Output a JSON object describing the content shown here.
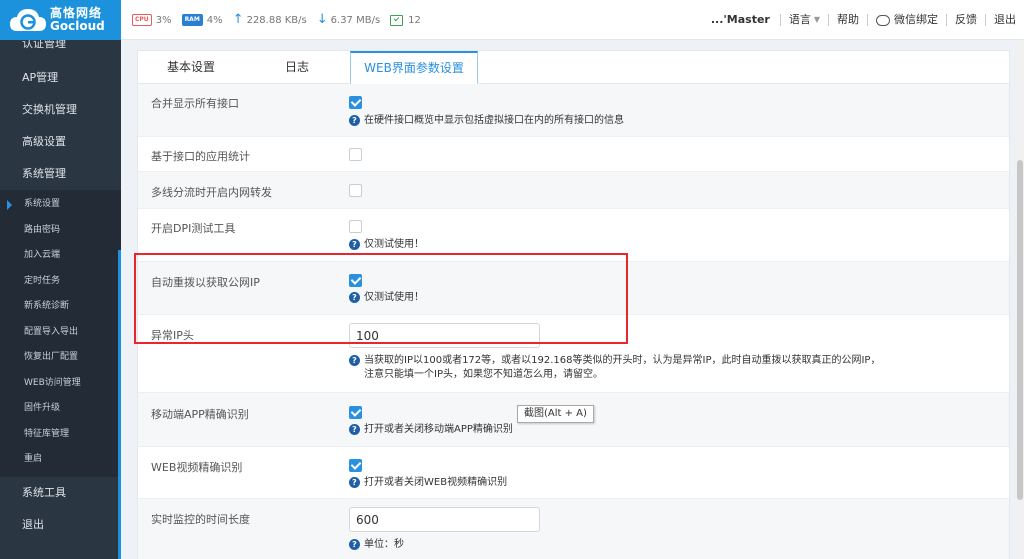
{
  "brand": {
    "name_cn": "高恪网络",
    "name_en": "Gocloud",
    "color": "#1c92dd"
  },
  "stats": {
    "cpu_chip": "CPU",
    "cpu": "3%",
    "ram_chip": "RAM",
    "ram": "4%",
    "upload": "228.88 KB/s",
    "download": "6.37 MB/s",
    "devices": "12"
  },
  "topnav": {
    "user": "...'Master",
    "language": "语言",
    "help": "帮助",
    "wechat": "微信绑定",
    "feedback": "反馈",
    "logout": "退出"
  },
  "sidebar": {
    "items_top": [
      "认证管理",
      "AP管理",
      "交换机管理",
      "高级设置",
      "系统管理"
    ],
    "submenu": [
      "系统设置",
      "路由密码",
      "加入云端",
      "定时任务",
      "新系统诊断",
      "配置导入导出",
      "恢复出厂配置",
      "WEB访问管理",
      "固件升级",
      "特征库管理",
      "重启"
    ],
    "active_sub": "系统设置",
    "items_bottom": [
      "系统工具",
      "退出"
    ]
  },
  "tabs": [
    {
      "label": "基本设置",
      "active": false
    },
    {
      "label": "日志",
      "active": false
    },
    {
      "label": "WEB界面参数设置",
      "active": true
    }
  ],
  "rows": {
    "merge_ports": {
      "label": "合并显示所有接口",
      "checked": true,
      "help": "在硬件接口概览中显示包括虚拟接口在内的所有接口的信息"
    },
    "app_stats": {
      "label": "基于接口的应用统计",
      "checked": false
    },
    "multiline": {
      "label": "多线分流时开启内网转发",
      "checked": false
    },
    "dpi": {
      "label": "开启DPI测试工具",
      "checked": false,
      "help": "仅测试使用！"
    },
    "auto_redial": {
      "label": "自动重拨以获取公网IP",
      "checked": true,
      "help": "仅测试使用！"
    },
    "abnormal_ip": {
      "label": "异常IP头",
      "value": "100",
      "help_line1": "当获取的IP以100或者172等，或者以192.168等类似的开头时，认为是异常IP，此时自动重拨以获取真正的公网IP，",
      "help_line2": "注意只能填一个IP头，如果您不知道怎么用，请留空。"
    },
    "mobile_app": {
      "label": "移动端APP精确识别",
      "checked": true,
      "help": "打开或者关闭移动端APP精确识别"
    },
    "web_video": {
      "label": "WEB视频精确识别",
      "checked": true,
      "help": "打开或者关闭WEB视频精确识别"
    },
    "monitor_time": {
      "label": "实时监控的时间长度",
      "value": "600",
      "help": "单位：秒"
    }
  },
  "tooltip": "截图(Alt + A)",
  "colors": {
    "accent": "#2a90e0",
    "sidebar": "#2b3643",
    "highlight_box": "#e8262b"
  }
}
